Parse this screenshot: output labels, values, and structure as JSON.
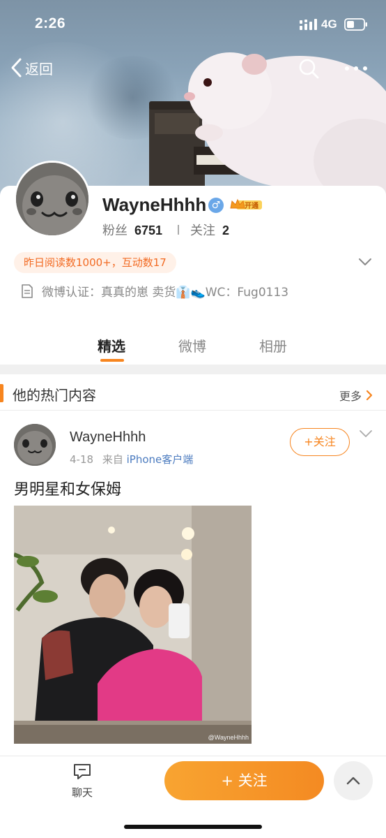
{
  "status_bar": {
    "time": "2:26",
    "network": "4G"
  },
  "nav": {
    "back_label": "返回"
  },
  "profile": {
    "username": "WayneHhhh",
    "gender_symbol": "♂",
    "vip_label": "开通",
    "followers_label": "粉丝",
    "followers_count": "6751",
    "following_label": "关注",
    "following_count": "2",
    "highlight": "昨日阅读数1000+，互动数17",
    "verification": "微博认证：真真的崽  卖货👔👟WC：Fug0113"
  },
  "tabs": [
    {
      "label": "精选",
      "active": true
    },
    {
      "label": "微博",
      "active": false
    },
    {
      "label": "相册",
      "active": false
    }
  ],
  "section": {
    "title": "他的热门内容",
    "more_label": "更多"
  },
  "post": {
    "author": "WayneHhhh",
    "date": "4-18",
    "source_prefix": "来自",
    "source": "iPhone客户端",
    "follow_label": "+关注",
    "text": "男明星和女保姆",
    "watermark": "@WayneHhhh"
  },
  "bottom_bar": {
    "chat_label": "聊天",
    "follow_label": "+ 关注"
  },
  "colors": {
    "accent": "#f7851f",
    "link": "#4b7bbf",
    "badge_bg": "#fff1e8",
    "badge_text": "#f26a22"
  }
}
